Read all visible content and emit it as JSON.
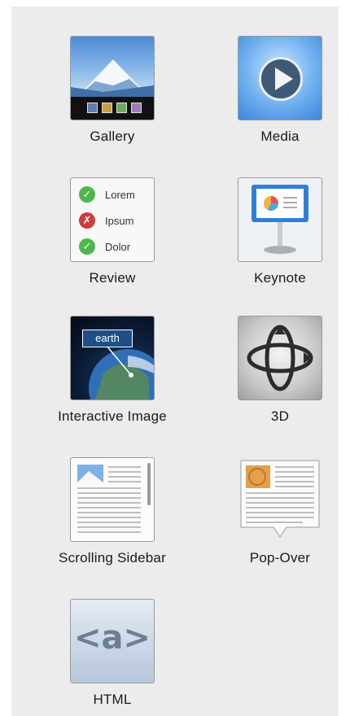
{
  "widgets": [
    {
      "id": "gallery",
      "label": "Gallery"
    },
    {
      "id": "media",
      "label": "Media"
    },
    {
      "id": "review",
      "label": "Review"
    },
    {
      "id": "keynote",
      "label": "Keynote"
    },
    {
      "id": "interactive",
      "label": "Interactive Image"
    },
    {
      "id": "3d",
      "label": "3D"
    },
    {
      "id": "scrolling",
      "label": "Scrolling Sidebar"
    },
    {
      "id": "popover",
      "label": "Pop-Over"
    },
    {
      "id": "html",
      "label": "HTML"
    }
  ],
  "review_items": [
    {
      "text": "Lorem",
      "status": "check",
      "color": "#4cb84c"
    },
    {
      "text": "Ipsum",
      "status": "cross",
      "color": "#d13b3b"
    },
    {
      "text": "Dolor",
      "status": "check",
      "color": "#4cb84c"
    }
  ],
  "interactive_image_tag": "earth",
  "html_icon_text": "<a>",
  "colors": {
    "panel_bg": "#ececec",
    "label_text": "#1a1a1a",
    "icon_border": "#9a9a9a"
  }
}
